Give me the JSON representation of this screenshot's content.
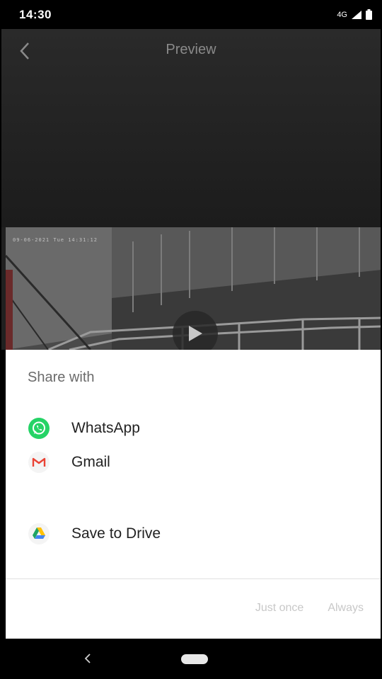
{
  "status_bar": {
    "time": "14:30",
    "network": "4G"
  },
  "header": {
    "title": "Preview"
  },
  "video": {
    "timestamp_overlay": "09-06-2021 Tue 14:31:12"
  },
  "share_sheet": {
    "title": "Share with",
    "items": [
      {
        "label": "WhatsApp",
        "icon": "whatsapp-icon",
        "color": "#25D366"
      },
      {
        "label": "Gmail",
        "icon": "gmail-icon",
        "color": "#EA4335"
      },
      {
        "label": "Save to Drive",
        "icon": "drive-icon",
        "color": "#1FA463"
      }
    ],
    "actions": {
      "just_once": "Just once",
      "always": "Always"
    }
  },
  "nav_bar": {
    "back_icon": "nav-back-icon",
    "home_icon": "home-pill-icon"
  }
}
